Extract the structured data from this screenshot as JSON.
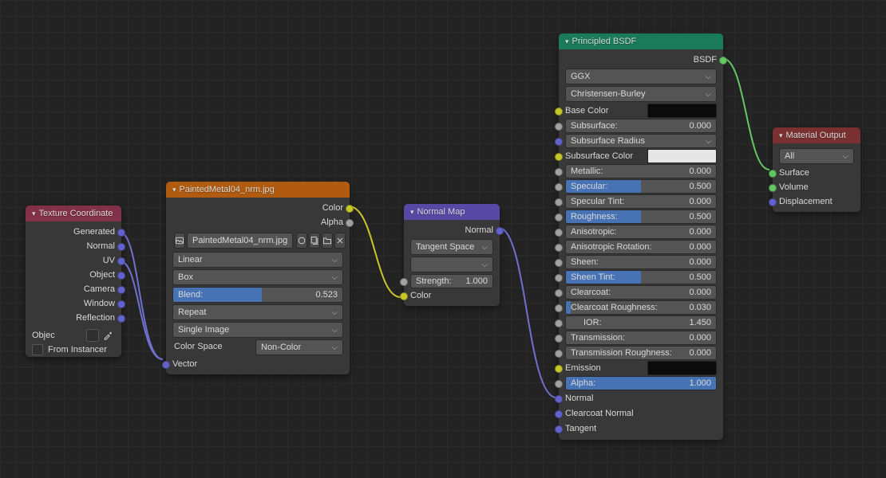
{
  "texcoord": {
    "title": "Texture Coordinate",
    "outputs": [
      "Generated",
      "Normal",
      "UV",
      "Object",
      "Camera",
      "Window",
      "Reflection"
    ],
    "object_label": "Objec",
    "from_instancer": "From Instancer"
  },
  "imgtex": {
    "title": "PaintedMetal04_nrm.jpg",
    "out_color": "Color",
    "out_alpha": "Alpha",
    "file_name": "PaintedMetal04_nrm.jpg",
    "interp": "Linear",
    "projection": "Box",
    "blend_label": "Blend:",
    "blend_value": "0.523",
    "blend_frac": 0.523,
    "extension": "Repeat",
    "source": "Single Image",
    "colorspace_label": "Color Space",
    "colorspace_value": "Non-Color",
    "in_vector": "Vector"
  },
  "normalmap": {
    "title": "Normal Map",
    "out_normal": "Normal",
    "space": "Tangent Space",
    "uvmap": "",
    "strength_label": "Strength:",
    "strength_value": "1.000",
    "in_color": "Color"
  },
  "principled": {
    "title": "Principled BSDF",
    "out_bsdf": "BSDF",
    "distribution": "GGX",
    "sss_method": "Christensen-Burley",
    "props": [
      {
        "name": "Base Color",
        "sock": "col",
        "kind": "swatch",
        "swatch": "#0b0b0b"
      },
      {
        "name": "Subsurface:",
        "sock": "val",
        "kind": "num",
        "val": "0.000",
        "frac": 0
      },
      {
        "name": "Subsurface Radius",
        "sock": "vec",
        "kind": "sel"
      },
      {
        "name": "Subsurface Color",
        "sock": "col",
        "kind": "swatch",
        "swatch": "#e6e6e6"
      },
      {
        "name": "Metallic:",
        "sock": "val",
        "kind": "num",
        "val": "0.000",
        "frac": 0
      },
      {
        "name": "Specular:",
        "sock": "val",
        "kind": "num",
        "val": "0.500",
        "frac": 0.5
      },
      {
        "name": "Specular Tint:",
        "sock": "val",
        "kind": "num",
        "val": "0.000",
        "frac": 0
      },
      {
        "name": "Roughness:",
        "sock": "val",
        "kind": "num",
        "val": "0.500",
        "frac": 0.5
      },
      {
        "name": "Anisotropic:",
        "sock": "val",
        "kind": "num",
        "val": "0.000",
        "frac": 0
      },
      {
        "name": "Anisotropic Rotation:",
        "sock": "val",
        "kind": "num",
        "val": "0.000",
        "frac": 0
      },
      {
        "name": "Sheen:",
        "sock": "val",
        "kind": "num",
        "val": "0.000",
        "frac": 0
      },
      {
        "name": "Sheen Tint:",
        "sock": "val",
        "kind": "num",
        "val": "0.500",
        "frac": 0.5
      },
      {
        "name": "Clearcoat:",
        "sock": "val",
        "kind": "num",
        "val": "0.000",
        "frac": 0
      },
      {
        "name": "Clearcoat Roughness:",
        "sock": "val",
        "kind": "num",
        "val": "0.030",
        "frac": 0.03
      },
      {
        "name": "IOR:",
        "sock": "val",
        "kind": "num",
        "val": "1.450",
        "frac": 0,
        "center": true
      },
      {
        "name": "Transmission:",
        "sock": "val",
        "kind": "num",
        "val": "0.000",
        "frac": 0
      },
      {
        "name": "Transmission Roughness:",
        "sock": "val",
        "kind": "num",
        "val": "0.000",
        "frac": 0
      },
      {
        "name": "Emission",
        "sock": "col",
        "kind": "swatch",
        "swatch": "#0b0b0b"
      },
      {
        "name": "Alpha:",
        "sock": "val",
        "kind": "num",
        "val": "1.000",
        "frac": 1
      },
      {
        "name": "Normal",
        "sock": "vec",
        "kind": "label"
      },
      {
        "name": "Clearcoat Normal",
        "sock": "vec",
        "kind": "label"
      },
      {
        "name": "Tangent",
        "sock": "vec",
        "kind": "label"
      }
    ]
  },
  "matout": {
    "title": "Material Output",
    "target": "All",
    "inputs": [
      "Surface",
      "Volume",
      "Displacement"
    ]
  },
  "colors": {
    "hdr_red": "#83314a",
    "hdr_orange": "#b05b0f",
    "hdr_purple": "#5848a6",
    "hdr_green": "#1a7a5a",
    "hdr_darkred": "#7a3030"
  }
}
